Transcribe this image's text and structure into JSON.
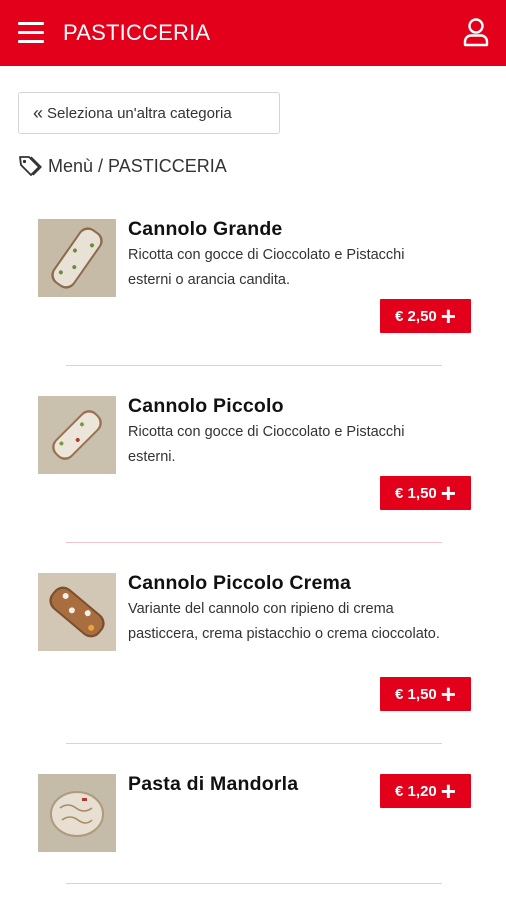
{
  "header": {
    "title": "PASTICCERIA",
    "menu_icon": "hamburger-menu-icon",
    "user_icon": "user-icon",
    "accent_color": "#e3001b"
  },
  "back_button": {
    "chevron": "«",
    "label": "Seleziona un'altra categoria"
  },
  "breadcrumb": {
    "icon": "tag-icon",
    "text": "Menù / PASTICCERIA"
  },
  "products": [
    {
      "name": "Cannolo Grande",
      "description": "Ricotta con gocce di Cioccolato e Pistacchi esterni o arancia candita.",
      "price": "€ 2,50",
      "add_icon": "plus-icon"
    },
    {
      "name": "Cannolo Piccolo",
      "description": "Ricotta con gocce di Cioccolato e Pistacchi esterni.",
      "price": "€ 1,50",
      "add_icon": "plus-icon"
    },
    {
      "name": "Cannolo Piccolo Crema",
      "description": "Variante del cannolo con ripieno di crema pasticcera, crema pistacchio o crema cioccolato.",
      "price": "€ 1,50",
      "add_icon": "plus-icon"
    },
    {
      "name": "Pasta di Mandorla",
      "description": "",
      "price": "€ 1,20",
      "add_icon": "plus-icon"
    }
  ]
}
